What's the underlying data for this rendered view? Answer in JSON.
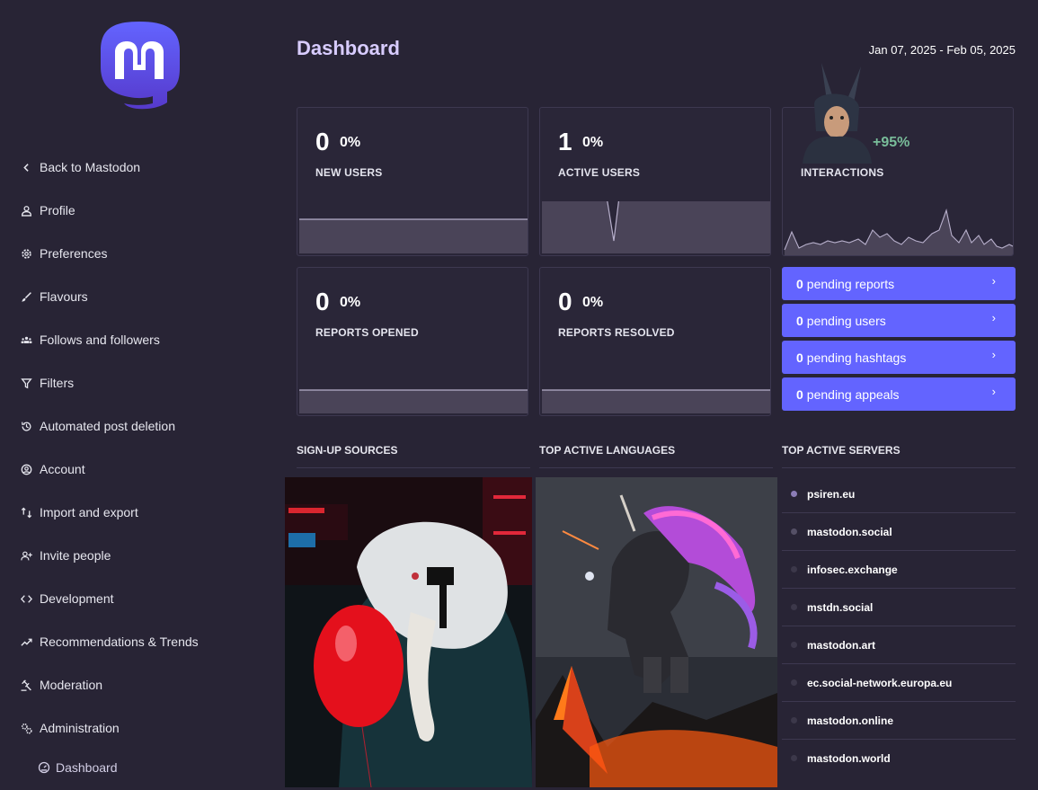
{
  "sidebar": {
    "items": [
      {
        "label": "Back to Mastodon",
        "icon": "chevron-left-icon"
      },
      {
        "label": "Profile",
        "icon": "person-icon"
      },
      {
        "label": "Preferences",
        "icon": "gear-icon"
      },
      {
        "label": "Flavours",
        "icon": "brush-icon"
      },
      {
        "label": "Follows and followers",
        "icon": "people-icon"
      },
      {
        "label": "Filters",
        "icon": "filter-icon"
      },
      {
        "label": "Automated post deletion",
        "icon": "history-icon"
      },
      {
        "label": "Account",
        "icon": "account-circle-icon"
      },
      {
        "label": "Import and export",
        "icon": "import-export-icon"
      },
      {
        "label": "Invite people",
        "icon": "person-add-icon"
      },
      {
        "label": "Development",
        "icon": "code-icon"
      },
      {
        "label": "Recommendations & Trends",
        "icon": "trending-up-icon"
      },
      {
        "label": "Moderation",
        "icon": "gavel-icon"
      },
      {
        "label": "Administration",
        "icon": "admin-gears-icon"
      }
    ],
    "sub_item": {
      "label": "Dashboard",
      "icon": "speedometer-icon"
    }
  },
  "header": {
    "title": "Dashboard",
    "date_range": "Jan 07, 2025 - Feb 05, 2025"
  },
  "metrics": [
    {
      "value": "0",
      "change": "0%",
      "label": "NEW USERS"
    },
    {
      "value": "1",
      "change": "0%",
      "label": "ACTIVE USERS"
    },
    {
      "value": "",
      "change": "+95%",
      "label": "INTERACTIONS"
    },
    {
      "value": "0",
      "change": "0%",
      "label": "REPORTS OPENED"
    },
    {
      "value": "0",
      "change": "0%",
      "label": "REPORTS RESOLVED"
    }
  ],
  "pending": [
    {
      "count": "0",
      "label": "pending reports"
    },
    {
      "count": "0",
      "label": "pending users"
    },
    {
      "count": "0",
      "label": "pending hashtags"
    },
    {
      "count": "0",
      "label": "pending appeals"
    }
  ],
  "sections": {
    "signup": "SIGN-UP SOURCES",
    "languages": "TOP ACTIVE LANGUAGES",
    "servers": "TOP ACTIVE SERVERS"
  },
  "servers": [
    {
      "name": "psiren.eu",
      "dot": "#8c7db7"
    },
    {
      "name": "mastodon.social",
      "dot": "#555066"
    },
    {
      "name": "infosec.exchange",
      "dot": "#3c384a"
    },
    {
      "name": "mstdn.social",
      "dot": "#3c384a"
    },
    {
      "name": "mastodon.art",
      "dot": "#3c384a"
    },
    {
      "name": "ec.social-network.europa.eu",
      "dot": "#3c384a"
    },
    {
      "name": "mastodon.online",
      "dot": "#3c384a"
    },
    {
      "name": "mastodon.world",
      "dot": "#3c384a"
    }
  ],
  "colors": {
    "accent": "#6364ff",
    "title": "#d8ccff",
    "positive": "#79bd9a"
  }
}
